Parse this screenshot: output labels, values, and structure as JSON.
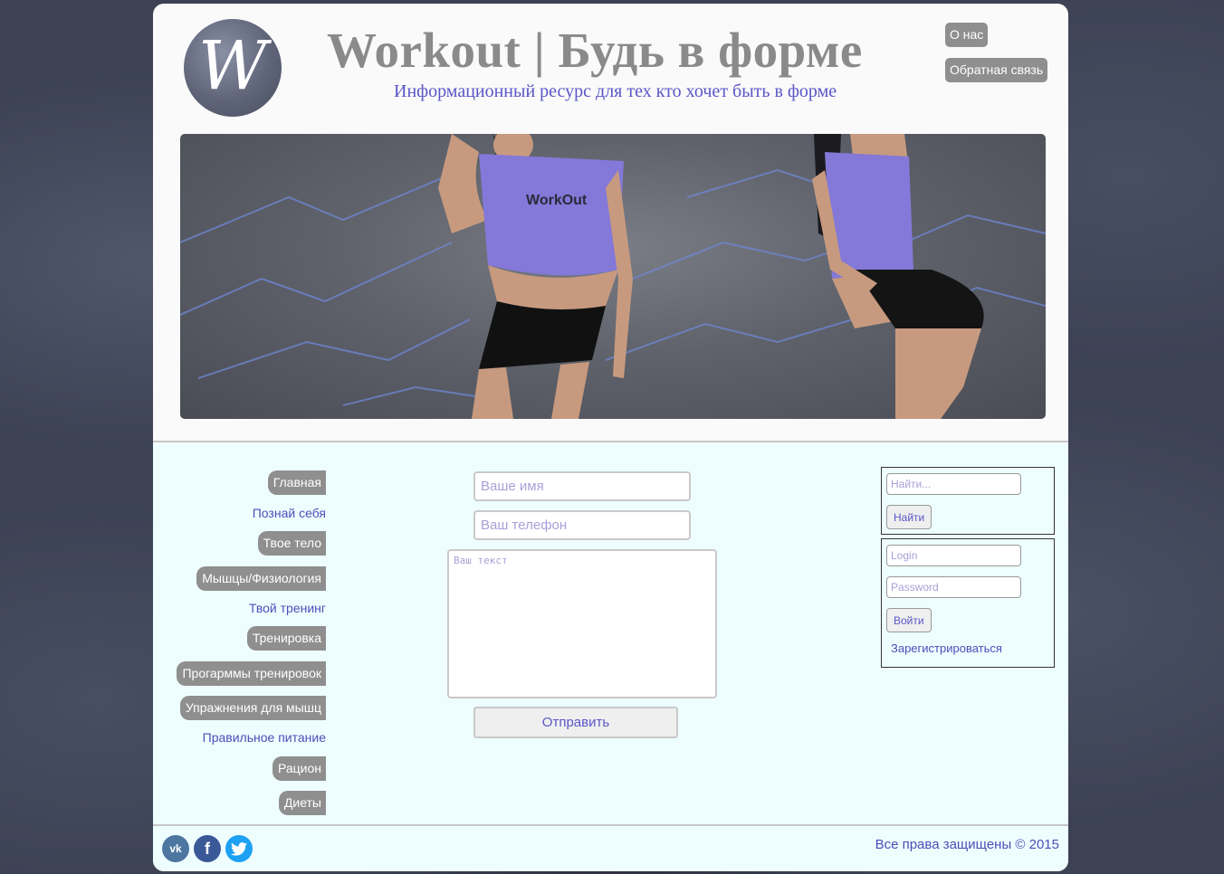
{
  "header": {
    "logo_letter": "W",
    "title": "Workout | Будь в форме",
    "subtitle": "Информационный ресурс для тех кто хочет быть в форме",
    "buttons": {
      "about": "О нас",
      "feedback": "Обратная связь"
    }
  },
  "banner": {
    "shirt_text": "WorkOut"
  },
  "nav": {
    "items": [
      {
        "label": "Главная",
        "style": "pill"
      },
      {
        "label": "Познай себя",
        "style": "link"
      },
      {
        "label": "Твое тело",
        "style": "pill"
      },
      {
        "label": "Мышцы/Физиология",
        "style": "pill"
      },
      {
        "label": "Твой тренинг",
        "style": "link"
      },
      {
        "label": "Тренировка",
        "style": "pill"
      },
      {
        "label": "Прогарммы тренировок",
        "style": "pill"
      },
      {
        "label": "Упражнения для мышц",
        "style": "pill"
      },
      {
        "label": "Правильное питание",
        "style": "link"
      },
      {
        "label": "Рацион",
        "style": "pill"
      },
      {
        "label": "Диеты",
        "style": "pill"
      }
    ]
  },
  "form": {
    "name_placeholder": "Ваше имя",
    "phone_placeholder": "Ваш телефон",
    "text_placeholder": "Ваш текст",
    "submit_label": "Отправить"
  },
  "search": {
    "placeholder": "Найти...",
    "button_label": "Найти"
  },
  "login": {
    "login_placeholder": "Login",
    "password_placeholder": "Password",
    "button_label": "Войти",
    "register_label": "Зарегистрироваться"
  },
  "footer": {
    "socials": [
      "vk-icon",
      "facebook-icon",
      "twitter-icon"
    ],
    "copyright": "Все права защищены © 2015"
  },
  "colors": {
    "accent": "#5a56c8",
    "link": "#4d4db8",
    "pill_bg": "#8f8f8f",
    "content_bg": "#eefeff",
    "title_gray": "#8a8a8a"
  }
}
